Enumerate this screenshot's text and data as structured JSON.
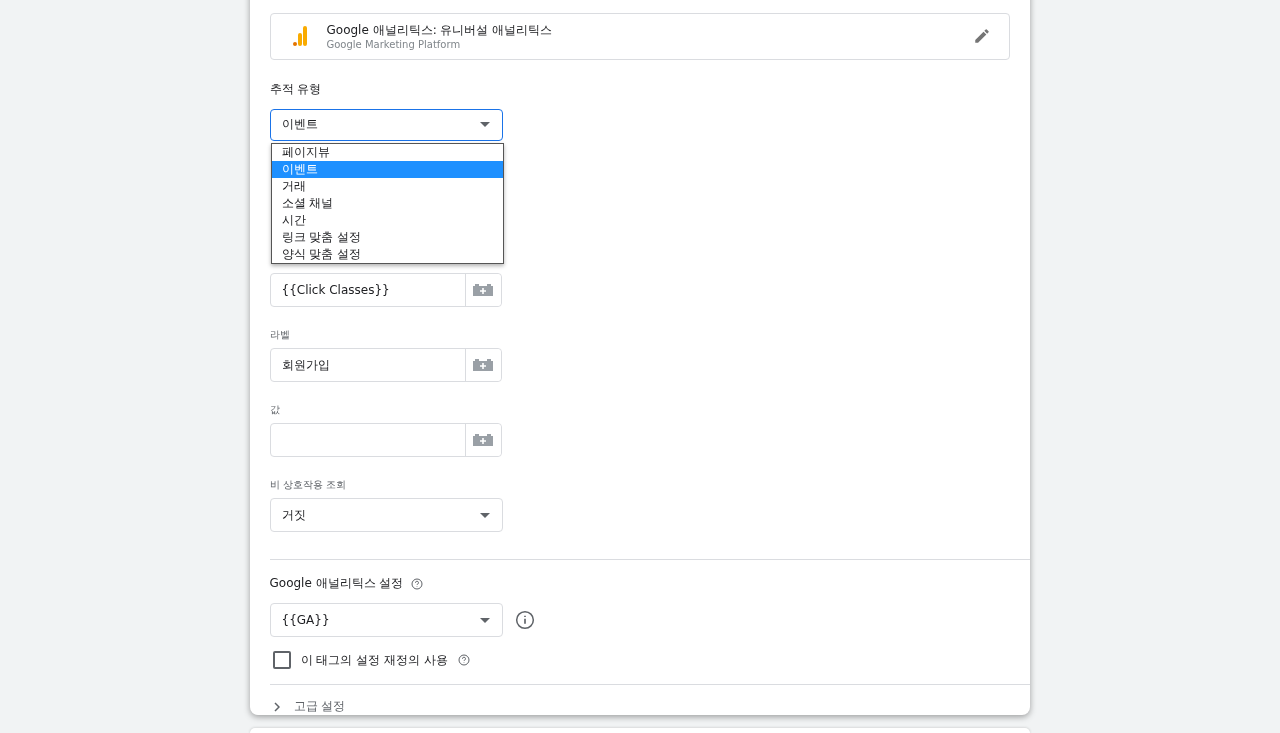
{
  "tag_type": {
    "title": "Google 애널리틱스: 유니버설 애널리틱스",
    "subtitle": "Google Marketing Platform"
  },
  "tracking_type": {
    "label": "추적 유형",
    "value": "이벤트",
    "expanded": true,
    "options": [
      {
        "label": "페이지뷰",
        "selected": false
      },
      {
        "label": "이벤트",
        "selected": true
      },
      {
        "label": "거래",
        "selected": false
      },
      {
        "label": "소셜 채널",
        "selected": false
      },
      {
        "label": "시간",
        "selected": false
      },
      {
        "label": "링크 맞춤 설정",
        "selected": false
      },
      {
        "label": "양식 맞춤 설정",
        "selected": false
      }
    ]
  },
  "fields": [
    {
      "value": "{{Click Classes}}"
    },
    {
      "label": "라벨",
      "value": "회원가입"
    },
    {
      "label": "값"
    }
  ],
  "non_interaction": {
    "label": "비 상호작용 조회",
    "value": "거짓"
  },
  "ga_settings": {
    "title": "Google 애널리틱스 설정",
    "value": "{{GA}}",
    "override_label": "이 태그의 설정 재정의 사용",
    "override_checked": false
  },
  "advanced": {
    "label": "고급 설정",
    "expanded": false
  }
}
